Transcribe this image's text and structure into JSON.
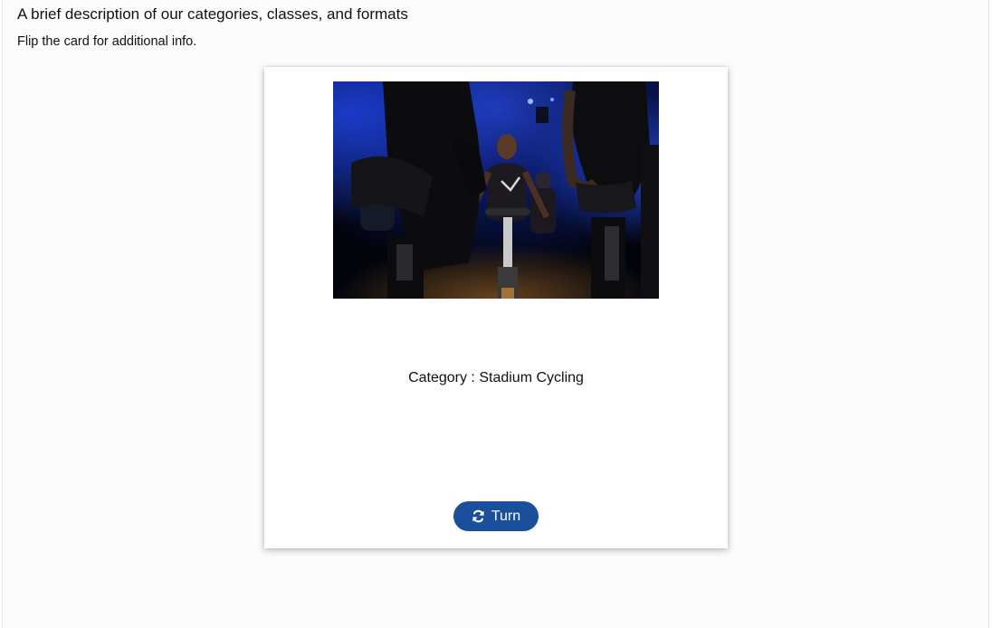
{
  "header": {
    "title": "A brief description of our categories, classes, and formats",
    "subtitle": "Flip the card for additional info."
  },
  "card": {
    "image_icon": "stadium-cycling-photo",
    "category_text": "Category : Stadium Cycling",
    "turn_button": {
      "label": "Turn",
      "icon": "refresh-icon",
      "color": "#1a4f9c"
    }
  },
  "colors": {
    "card_background": "#ffffff",
    "page_background": "#fcfcfc"
  }
}
